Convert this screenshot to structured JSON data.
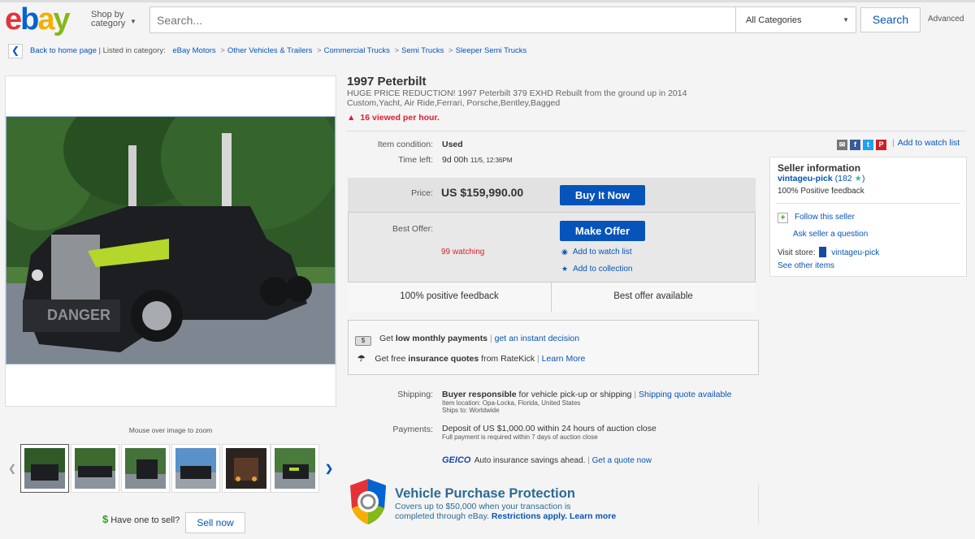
{
  "header": {
    "logo": [
      "e",
      "b",
      "a",
      "y"
    ],
    "shop_by": "Shop by category",
    "search_placeholder": "Search...",
    "category": "All Categories",
    "search_button": "Search",
    "advanced": "Advanced"
  },
  "breadcrumb": {
    "back": "Back to home page",
    "listed_in": "| Listed in category:",
    "items": [
      "eBay Motors",
      "Other Vehicles & Trailers",
      "Commercial Trucks",
      "Semi Trucks",
      "Sleeper Semi Trucks"
    ]
  },
  "gallery": {
    "zoom_hint": "Mouse over image to zoom",
    "thumb_count": 6,
    "selected_thumb": 0
  },
  "sell": {
    "icon": "$",
    "prompt": "Have one to sell?",
    "button": "Sell now"
  },
  "listing": {
    "title": "1997 Peterbilt",
    "subtitle": "HUGE PRICE REDUCTION! 1997 Peterbilt 379 EXHD Rebuilt from the ground up in 2014 Custom,Yacht, Air Ride,Ferrari, Porsche,Bentley,Bagged",
    "views": "16 viewed per hour."
  },
  "share": {
    "watch_list": "Add to watch list",
    "icons": [
      "email-icon",
      "facebook-icon",
      "twitter-icon",
      "pinterest-icon"
    ]
  },
  "details": {
    "condition_label": "Item condition:",
    "condition_value": "Used",
    "time_left_label": "Time left:",
    "time_left_value": "9d 00h",
    "time_left_date": "11/5, 12:36PM"
  },
  "buybox": {
    "price_label": "Price:",
    "price": "US $159,990.00",
    "buy_now": "Buy It Now",
    "best_offer_label": "Best Offer:",
    "make_offer": "Make Offer",
    "watching": "99 watching",
    "add_watch": "Add to watch list",
    "add_collection": "Add to collection",
    "positive_feedback": "100% positive feedback",
    "best_offer_available": "Best offer available"
  },
  "offers": {
    "payments_pre": "Get ",
    "payments_bold": "low monthly payments",
    "payments_link": "get an instant decision",
    "insurance_pre": "Get free ",
    "insurance_bold": "insurance quotes",
    "insurance_mid": " from RateKick",
    "insurance_link": "Learn More"
  },
  "shipping": {
    "label": "Shipping:",
    "responsible_bold": "Buyer responsible",
    "responsible_rest": " for vehicle pick-up or shipping",
    "quote_link": "Shipping quote available",
    "location": "Item location: Opa-Locka, Florida, United States",
    "ships_to": "Ships to: Worldwide"
  },
  "payments": {
    "label": "Payments:",
    "deposit": "Deposit of US $1,000.00 within 24 hours of auction close",
    "full": "Full payment is required within 7 days of auction close"
  },
  "geico": {
    "logo": "GEICO",
    "text": "Auto insurance savings ahead.",
    "link": "Get a quote now"
  },
  "protection": {
    "title": "Vehicle Purchase Protection",
    "line1": "Covers up to $50,000 when your transaction is",
    "line2": "completed through eBay.",
    "restrictions": "Restrictions apply.",
    "learn_more": "Learn more"
  },
  "seller": {
    "heading": "Seller information",
    "name": "vintageu-pick",
    "score": "(182",
    "star": "★",
    "score_close": ")",
    "positive": "100% Positive feedback",
    "follow": "Follow this seller",
    "ask": "Ask seller a question",
    "visit_label": "Visit store:",
    "store_name": "vintageu-pick",
    "other_items": "See other items"
  }
}
